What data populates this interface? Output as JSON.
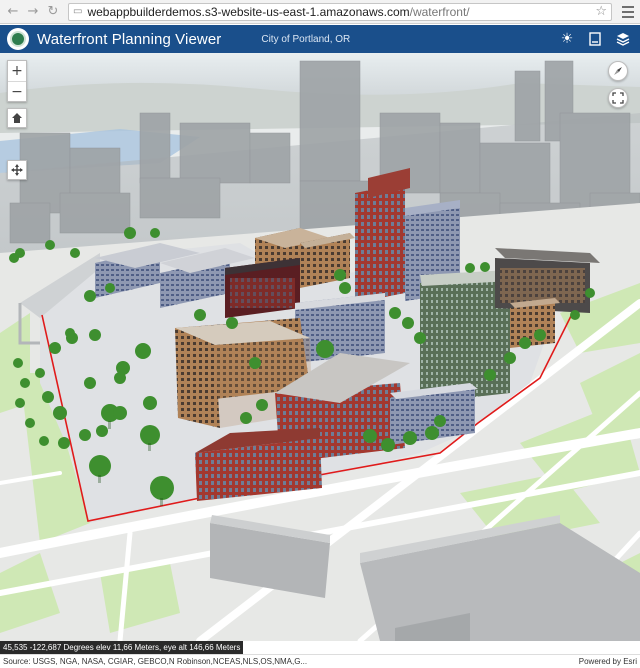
{
  "browser": {
    "back_icon": "arrow-left-icon",
    "forward_icon": "arrow-right-icon",
    "reload_icon": "reload-icon",
    "url_host": "webappbuilderdemos.s3-website-us-east-1.amazonaws.com",
    "url_path": "/waterfront/"
  },
  "header": {
    "title": "Waterfront Planning Viewer",
    "subtitle": "City of Portland, OR",
    "tools": [
      "daylight-icon",
      "layer-list-icon",
      "basemap-icon"
    ]
  },
  "map_controls": {
    "zoom_in": "+",
    "zoom_out": "−",
    "home_icon": "home-icon",
    "pan_icon": "pan-icon",
    "compass_icon": "compass-icon",
    "fullscreen_icon": "fullscreen-icon"
  },
  "status": {
    "coordinates": "45,535 -122,687 Degrees  elev 11,66 Meters,  eye alt 146,66 Meters",
    "source": "Source: USGS, NGA, NASA, CGIAR, GEBCO,N Robinson,NCEAS,NLS,OS,NMA,G...",
    "powered_by": "Powered by Esri"
  },
  "colors": {
    "header_bg": "#1a4f8b",
    "site_boundary": "#e01b1b",
    "park_green": "#cfe8b5",
    "tree_green": "#3e8f2f"
  }
}
